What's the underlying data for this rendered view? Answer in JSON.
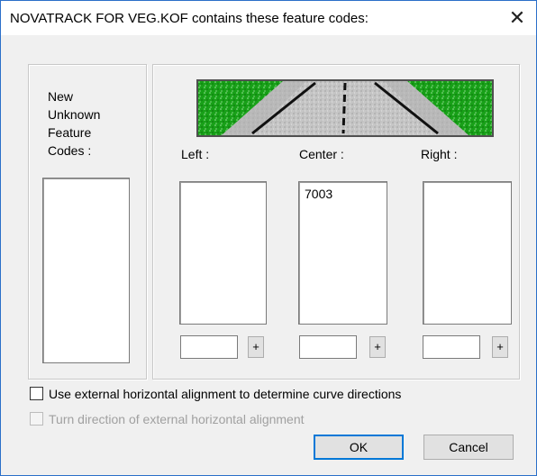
{
  "dialog": {
    "title": "NOVATRACK FOR VEG.KOF contains these feature codes:",
    "close_label": "✕"
  },
  "new_codes": {
    "label_lines": [
      "New",
      "Unknown",
      "Feature",
      "Codes :"
    ],
    "items": []
  },
  "columns": {
    "left": {
      "label": "Left :",
      "items": [],
      "input_value": "",
      "add_label": "+"
    },
    "center": {
      "label": "Center :",
      "items": [
        "7003"
      ],
      "input_value": "",
      "add_label": "+"
    },
    "right": {
      "label": "Right :",
      "items": [],
      "input_value": "",
      "add_label": "+"
    }
  },
  "options": {
    "use_external_alignment": {
      "label": "Use external horizontal alignment to determine curve directions",
      "checked": false,
      "enabled": true
    },
    "turn_direction": {
      "label": "Turn direction of external horizontal alignment",
      "checked": false,
      "enabled": false
    }
  },
  "buttons": {
    "ok": "OK",
    "cancel": "Cancel"
  },
  "colors": {
    "verge": "#1aa51a",
    "road": "#c4c4c4",
    "accent": "#0078d7",
    "border": "#2b6fc9"
  }
}
